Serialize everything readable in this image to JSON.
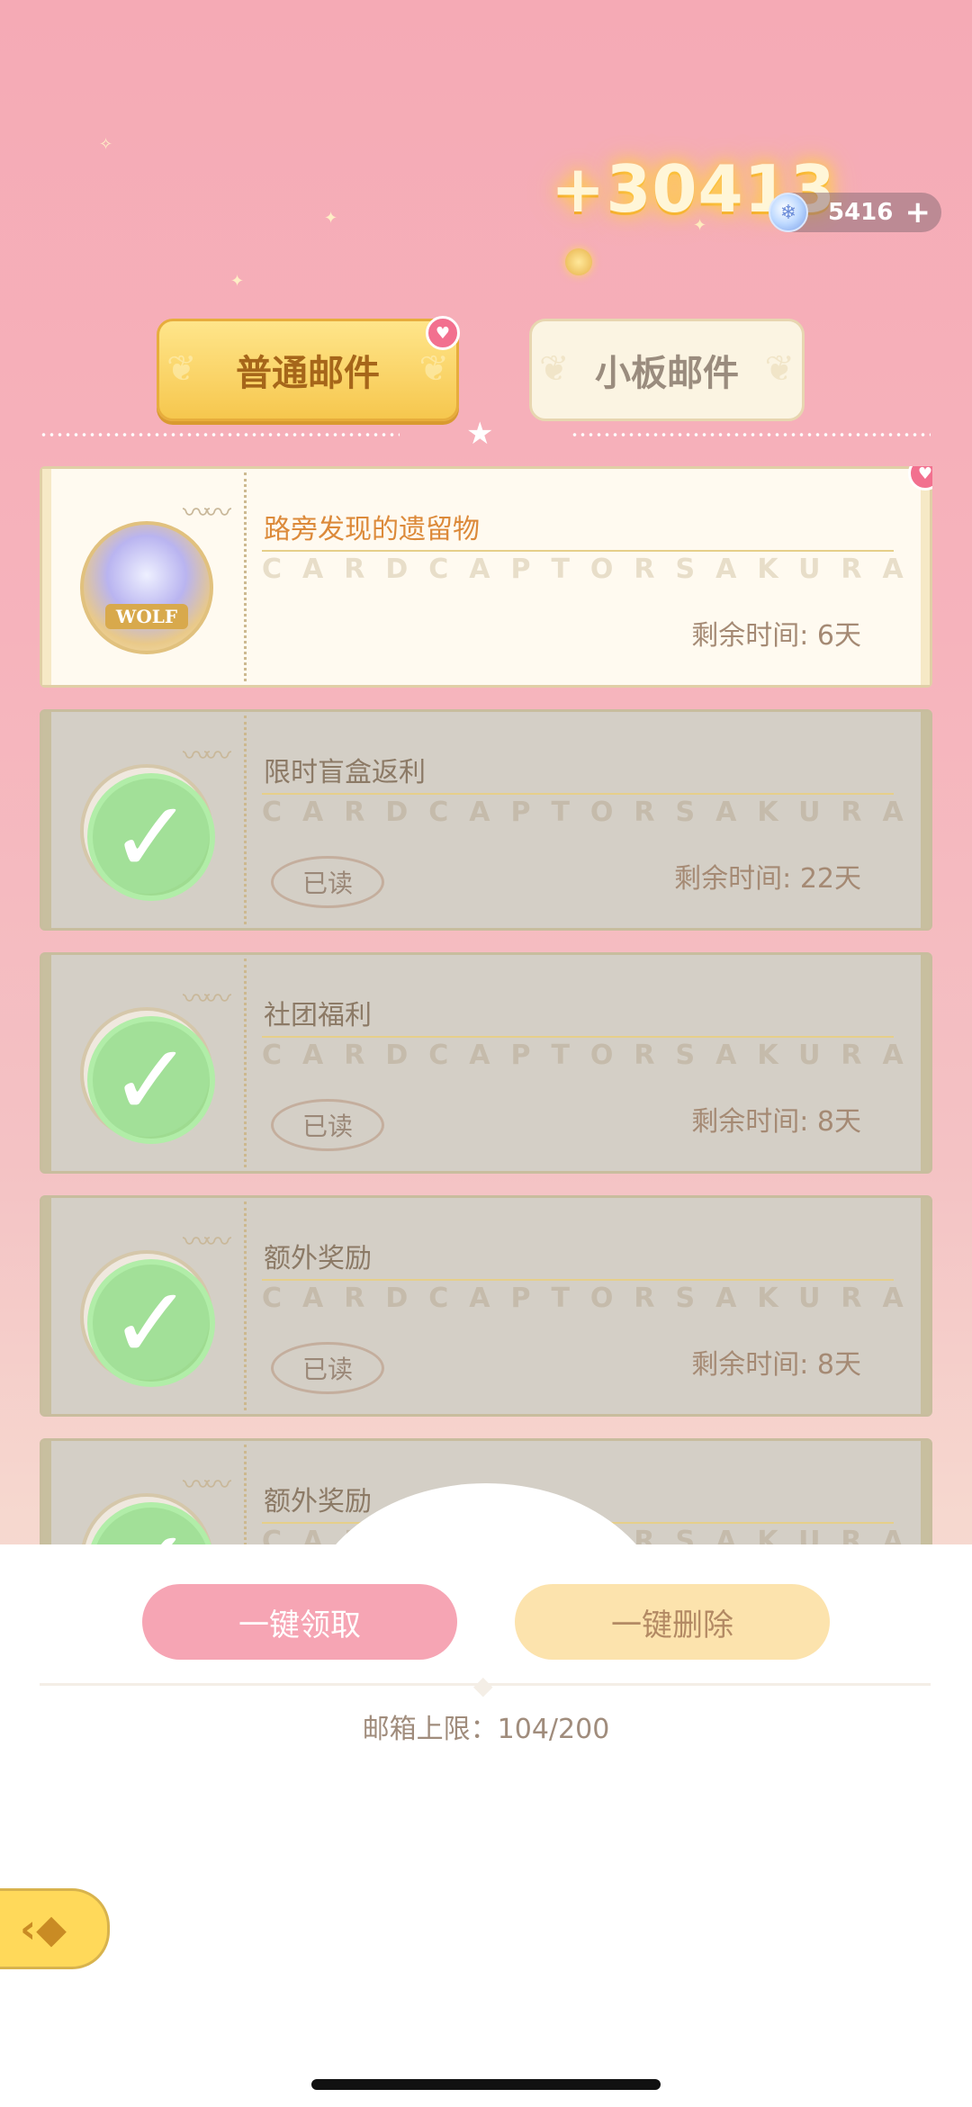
{
  "header": {
    "reward_gain": "+30413",
    "currency": {
      "icon": "gem-icon",
      "value": "5416",
      "add_icon": "plus-icon"
    }
  },
  "tabs": [
    {
      "label": "普通邮件",
      "active": true,
      "has_badge": true
    },
    {
      "label": "小板邮件",
      "active": false,
      "has_badge": false
    }
  ],
  "mails": [
    {
      "title": "路旁发现的遗留物",
      "watermark": "CARDCAPTORSAKURA",
      "remaining": "剩余时间: 6天",
      "read": false,
      "read_stamp": "",
      "stamp_label": "WOLF",
      "has_badge": true
    },
    {
      "title": "限时盲盒返利",
      "watermark": "CARDCAPTORSAKURA",
      "remaining": "剩余时间: 22天",
      "read": true,
      "read_stamp": "已读"
    },
    {
      "title": "社团福利",
      "watermark": "CARDCAPTORSAKURA",
      "remaining": "剩余时间: 8天",
      "read": true,
      "read_stamp": "已读"
    },
    {
      "title": "额外奖励",
      "watermark": "CARDCAPTORSAKURA",
      "remaining": "剩余时间: 8天",
      "read": true,
      "read_stamp": "已读"
    },
    {
      "title": "额外奖励",
      "watermark": "CARDCAPTORSAKURA",
      "remaining": "",
      "read": true,
      "read_stamp": ""
    }
  ],
  "actions": {
    "claim_all": "一键领取",
    "delete_all": "一键删除"
  },
  "mailbox_limit": "邮箱上限：104/200",
  "colors": {
    "claim_button": "#f6a5b4",
    "delete_button": "#fce3ad",
    "active_tab": "#f6c74e",
    "badge": "#f2708f",
    "read_check": "#94de8c"
  }
}
